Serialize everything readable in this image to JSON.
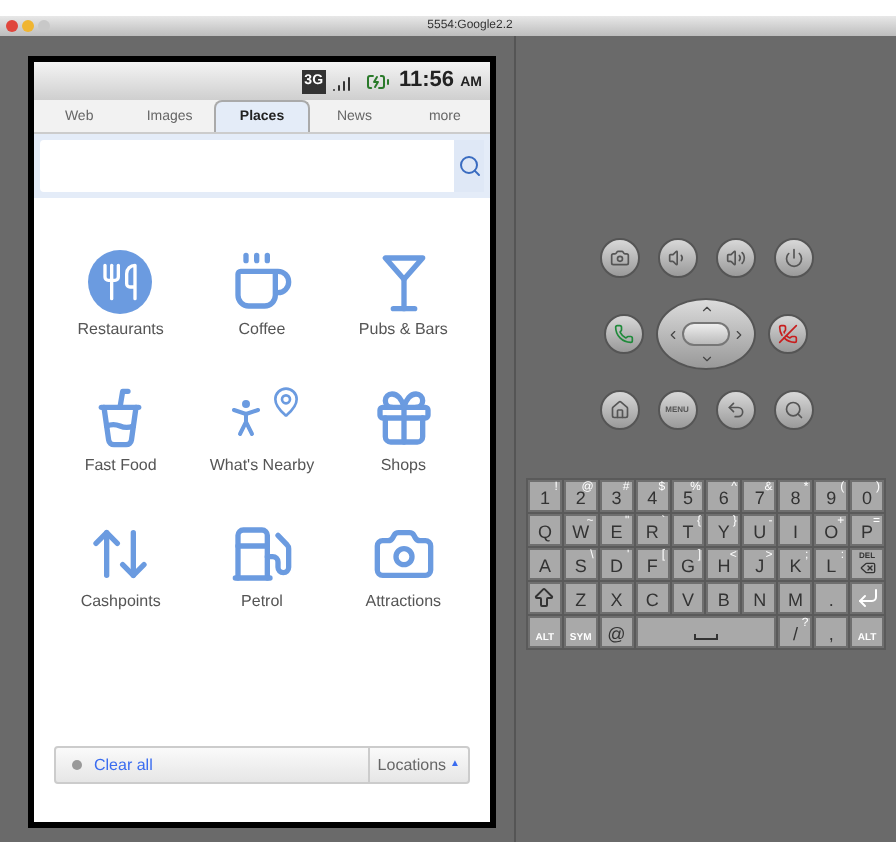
{
  "window": {
    "title": "5554:Google2.2"
  },
  "phone": {
    "status_bar": {
      "network": "3G",
      "time": "11:56",
      "meridiem": "AM"
    },
    "tabs": [
      {
        "label": "Web",
        "selected": false
      },
      {
        "label": "Images",
        "selected": false
      },
      {
        "label": "Places",
        "selected": true
      },
      {
        "label": "News",
        "selected": false
      },
      {
        "label": "more",
        "selected": false
      }
    ],
    "categories": [
      {
        "label": "Restaurants",
        "kind": "restaurants"
      },
      {
        "label": "Coffee",
        "kind": "coffee"
      },
      {
        "label": "Pubs & Bars",
        "kind": "bars"
      },
      {
        "label": "Fast Food",
        "kind": "fastfood"
      },
      {
        "label": "What's Nearby",
        "kind": "nearby"
      },
      {
        "label": "Shops",
        "kind": "shops"
      },
      {
        "label": "Cashpoints",
        "kind": "cash"
      },
      {
        "label": "Petrol",
        "kind": "petrol"
      },
      {
        "label": "Attractions",
        "kind": "attractions"
      }
    ],
    "bottom_bar": {
      "clear_link": "Clear all",
      "locations_button": "Locations",
      "locations_arrow": "▲"
    }
  },
  "controls": {
    "menu_label": "MENU"
  },
  "keyboard": {
    "rows": [
      [
        {
          "kind": "char",
          "main": "1",
          "alt": "!"
        },
        {
          "kind": "char",
          "main": "2",
          "alt": "@"
        },
        {
          "kind": "char",
          "main": "3",
          "alt": "#"
        },
        {
          "kind": "char",
          "main": "4",
          "alt": "$"
        },
        {
          "kind": "char",
          "main": "5",
          "alt": "%"
        },
        {
          "kind": "char",
          "main": "6",
          "alt": "^"
        },
        {
          "kind": "char",
          "main": "7",
          "alt": "&"
        },
        {
          "kind": "char",
          "main": "8",
          "alt": "*"
        },
        {
          "kind": "char",
          "main": "9",
          "alt": "("
        },
        {
          "kind": "char",
          "main": "0",
          "alt": ")"
        }
      ],
      [
        {
          "kind": "char",
          "main": "Q"
        },
        {
          "kind": "char",
          "main": "W",
          "alt": "~"
        },
        {
          "kind": "char",
          "main": "E",
          "alt": "\""
        },
        {
          "kind": "char",
          "main": "R",
          "alt": "`"
        },
        {
          "kind": "char",
          "main": "T",
          "alt": "{"
        },
        {
          "kind": "char",
          "main": "Y",
          "alt": "}"
        },
        {
          "kind": "char",
          "main": "U",
          "alt": "-"
        },
        {
          "kind": "char",
          "main": "I"
        },
        {
          "kind": "char",
          "main": "O",
          "alt": "+"
        },
        {
          "kind": "char",
          "main": "P",
          "alt": "="
        }
      ],
      [
        {
          "kind": "char",
          "main": "A"
        },
        {
          "kind": "char",
          "main": "S",
          "alt": "\\"
        },
        {
          "kind": "char",
          "main": "D",
          "alt": "'"
        },
        {
          "kind": "char",
          "main": "F",
          "alt": "["
        },
        {
          "kind": "char",
          "main": "G",
          "alt": "]"
        },
        {
          "kind": "char",
          "main": "H",
          "alt": "<"
        },
        {
          "kind": "char",
          "main": "J",
          "alt": ">"
        },
        {
          "kind": "char",
          "main": "K",
          "alt": ";"
        },
        {
          "kind": "char",
          "main": "L",
          "alt": ":"
        },
        {
          "kind": "del",
          "main": "DEL"
        }
      ],
      [
        {
          "kind": "shift"
        },
        {
          "kind": "char",
          "main": "Z"
        },
        {
          "kind": "char",
          "main": "X"
        },
        {
          "kind": "char",
          "main": "C"
        },
        {
          "kind": "char",
          "main": "V"
        },
        {
          "kind": "char",
          "main": "B"
        },
        {
          "kind": "char",
          "main": "N"
        },
        {
          "kind": "char",
          "main": "M"
        },
        {
          "kind": "char",
          "main": "."
        },
        {
          "kind": "enter"
        }
      ]
    ],
    "bottom_row": [
      {
        "kind": "char",
        "main": "ALT"
      },
      {
        "kind": "char",
        "main": "SYM"
      },
      {
        "kind": "char",
        "main": "@"
      },
      {
        "kind": "space"
      },
      {
        "kind": "char",
        "main": "/",
        "alt": "?"
      },
      {
        "kind": "char",
        "main": ","
      },
      {
        "kind": "char",
        "main": "ALT"
      }
    ]
  }
}
